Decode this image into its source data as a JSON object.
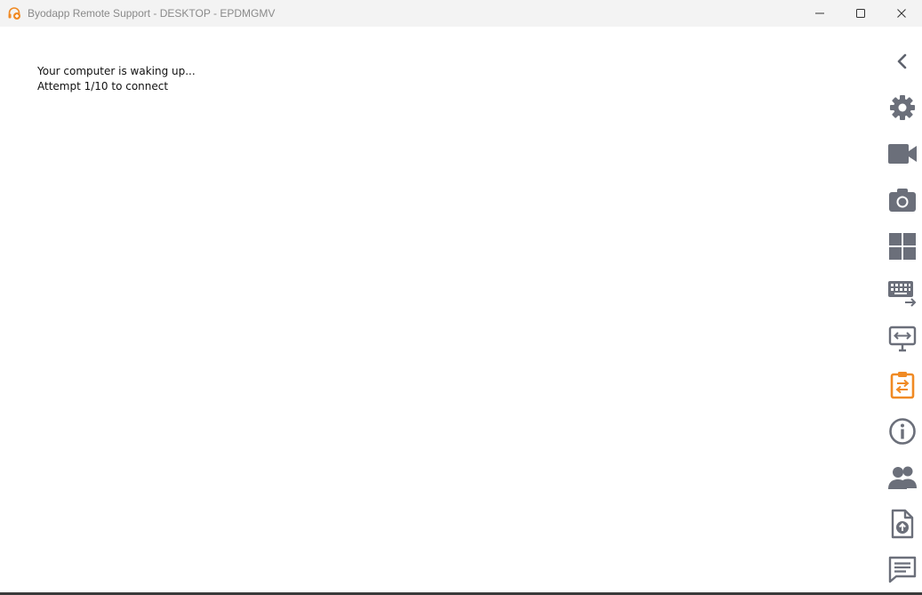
{
  "window": {
    "title": "Byodapp Remote Support - DESKTOP - EPDMGMV",
    "icon": "headset-plus-icon",
    "accent_color": "#f08a24"
  },
  "main": {
    "status_line1": "Your computer is waking up...",
    "status_line2": "Attempt 1/10 to connect"
  },
  "toolbar": {
    "icon_color": "#6b6f7a",
    "active_color": "#f08a24",
    "items": [
      {
        "icon": "chevron-left-icon",
        "action": "collapse"
      },
      {
        "icon": "gear-icon",
        "action": "settings"
      },
      {
        "icon": "video-camera-icon",
        "action": "record"
      },
      {
        "icon": "camera-icon",
        "action": "screenshot"
      },
      {
        "icon": "windows-icon",
        "action": "windows-key"
      },
      {
        "icon": "keyboard-icon",
        "action": "send-keys"
      },
      {
        "icon": "monitor-fit-icon",
        "action": "fit-screen"
      },
      {
        "icon": "clipboard-sync-icon",
        "action": "clipboard-sync",
        "active": true
      },
      {
        "icon": "info-icon",
        "action": "info"
      },
      {
        "icon": "users-icon",
        "action": "participants"
      },
      {
        "icon": "file-upload-icon",
        "action": "file-transfer"
      },
      {
        "icon": "chat-icon",
        "action": "chat"
      }
    ]
  }
}
